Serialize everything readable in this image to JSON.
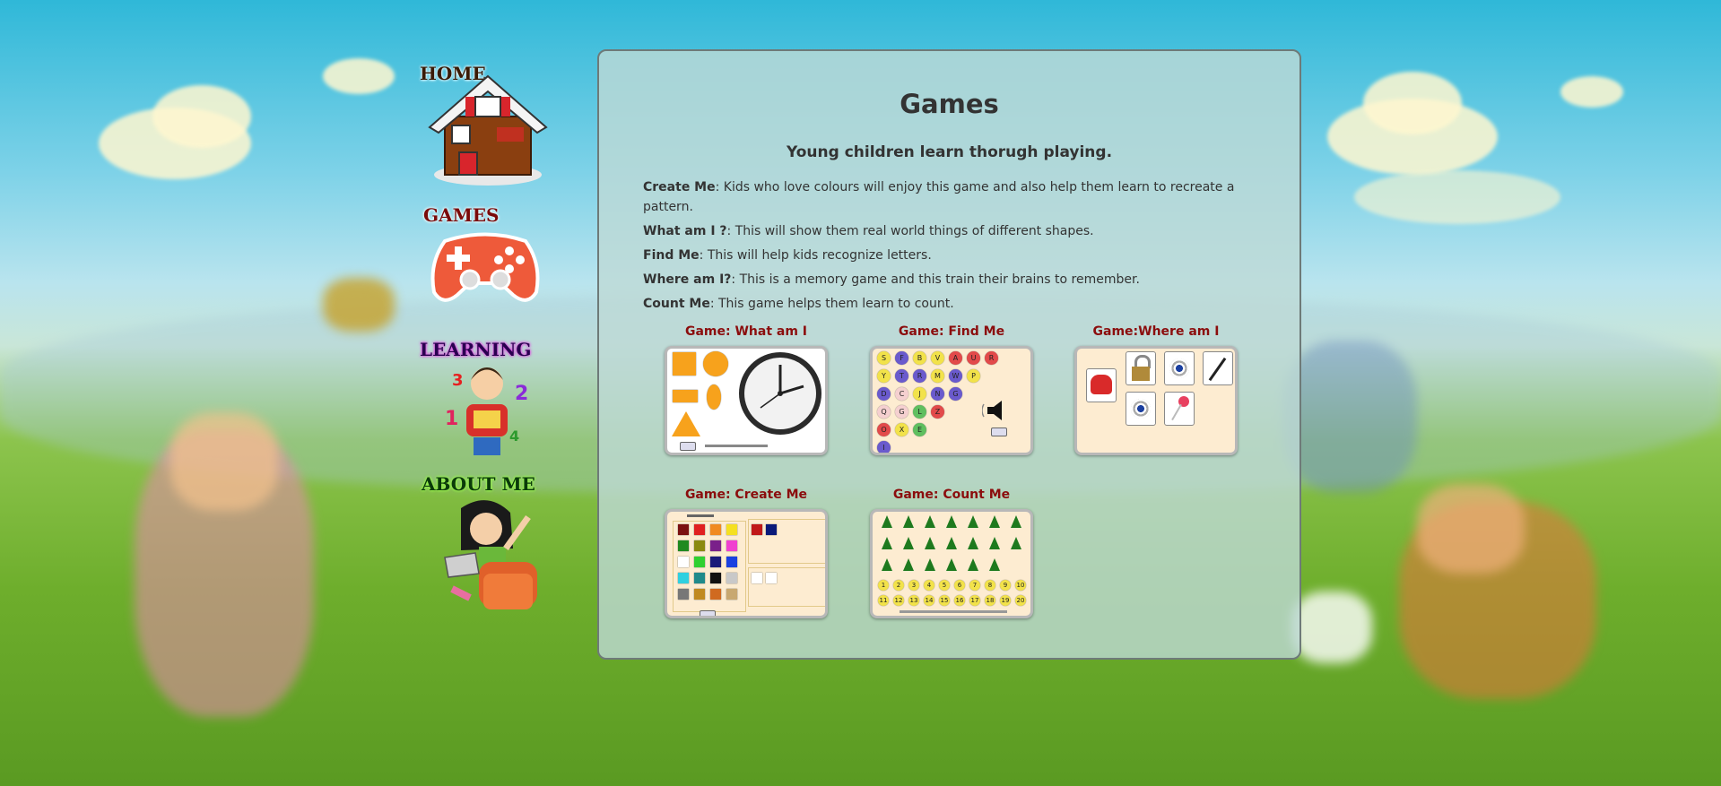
{
  "nav": {
    "home_label": "HOME",
    "games_label": "GAMES",
    "learning_label": "LEARNING",
    "about_label": "ABOUT ME"
  },
  "main": {
    "title": "Games",
    "subtitle": "Young children learn thorugh playing.",
    "descriptions": [
      {
        "name": "Create Me",
        "text": ": Kids who love colours will enjoy this game and also help them learn to recreate a pattern."
      },
      {
        "name": "What am I ?",
        "text": ": This will show them real world things of different shapes."
      },
      {
        "name": "Find Me",
        "text": ": This will help kids recognize letters."
      },
      {
        "name": "Where am I?",
        "text": ": This is a memory game and this train their brains to remember."
      },
      {
        "name": "Count Me",
        "text": ": This game helps them learn to count."
      }
    ],
    "games": [
      {
        "title": "Game: What am I"
      },
      {
        "title": "Game: Find Me"
      },
      {
        "title": "Game:Where am I"
      },
      {
        "title": "Game: Create Me"
      },
      {
        "title": "Game: Count Me"
      }
    ],
    "findme_letters": [
      "S",
      "F",
      "B",
      "V",
      "A",
      "U",
      "R",
      "Y",
      "T",
      "R",
      "M",
      "W",
      "P",
      "D",
      "C",
      "J",
      "N",
      "G",
      "Q",
      "G",
      "L",
      "Z",
      "O",
      "X",
      "E",
      "I"
    ],
    "countme_numbers": [
      "1",
      "2",
      "3",
      "4",
      "5",
      "6",
      "7",
      "8",
      "9",
      "10",
      "11",
      "12",
      "13",
      "14",
      "15",
      "16",
      "17",
      "18",
      "19",
      "20"
    ],
    "colors": {
      "title": "#333333",
      "game_title": "#8b0d0d",
      "panel_border": "#6e7a78"
    }
  }
}
